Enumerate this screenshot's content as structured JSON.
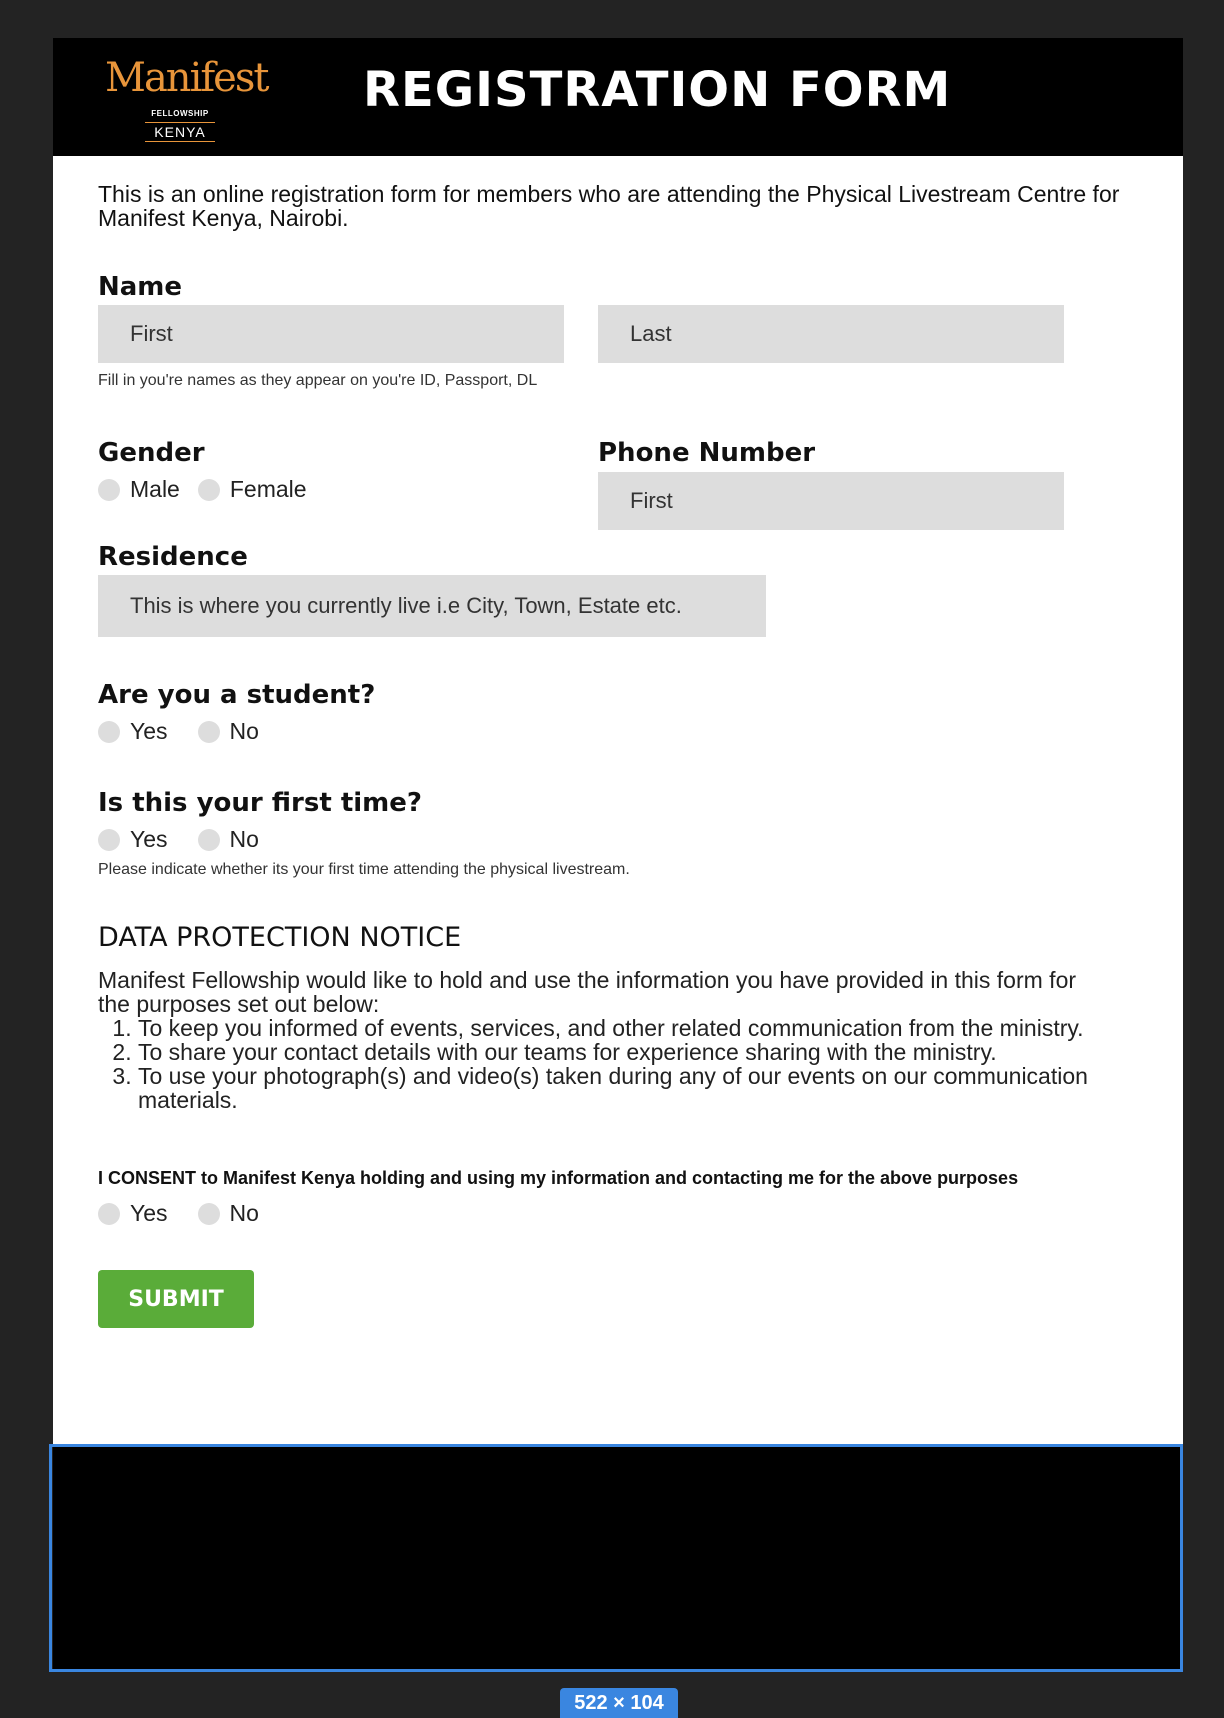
{
  "header": {
    "logo_brand": "Manifest",
    "logo_fellowship": "FELLOWSHIP",
    "logo_country": "KENYA",
    "title": "REGISTRATION FORM"
  },
  "intro": "This is an online registration form for members who are attending the Physical Livestream Centre for Manifest Kenya, Nairobi.",
  "name": {
    "label": "Name",
    "first_placeholder": "First",
    "last_placeholder": "Last",
    "hint": "Fill in you're names as they appear on you're ID, Passport, DL"
  },
  "gender": {
    "label": "Gender",
    "options": [
      "Male",
      "Female"
    ]
  },
  "phone": {
    "label": "Phone Number",
    "placeholder": "First"
  },
  "residence": {
    "label": "Residence",
    "placeholder": "This is where you currently live i.e City, Town, Estate etc."
  },
  "student": {
    "label": "Are you a student?",
    "options": [
      "Yes",
      "No"
    ]
  },
  "first_time": {
    "label": "Is this your first time?",
    "options": [
      "Yes",
      "No"
    ],
    "hint": "Please indicate whether its your first time attending the physical livestream."
  },
  "notice": {
    "title": "DATA PROTECTION NOTICE",
    "lead": "Manifest Fellowship would like to hold and use the information you have provided in this form for the purposes set out below:",
    "items": [
      "To keep you informed of events, services, and other related communication from the ministry.",
      "To share your contact details with our teams for experience sharing with the ministry.",
      "To use your photograph(s) and video(s) taken during any of our events on our communication materials."
    ]
  },
  "consent": {
    "label": "I CONSENT to Manifest Kenya holding and using my information and contacting me for the above purposes",
    "options": [
      "Yes",
      "No"
    ]
  },
  "submit_label": "SUBMIT",
  "selection_size": "522 × 104",
  "colors": {
    "accent_logo": "#e8953a",
    "submit": "#5aac39",
    "selection": "#3a86e0",
    "field_bg": "#dddddd"
  }
}
